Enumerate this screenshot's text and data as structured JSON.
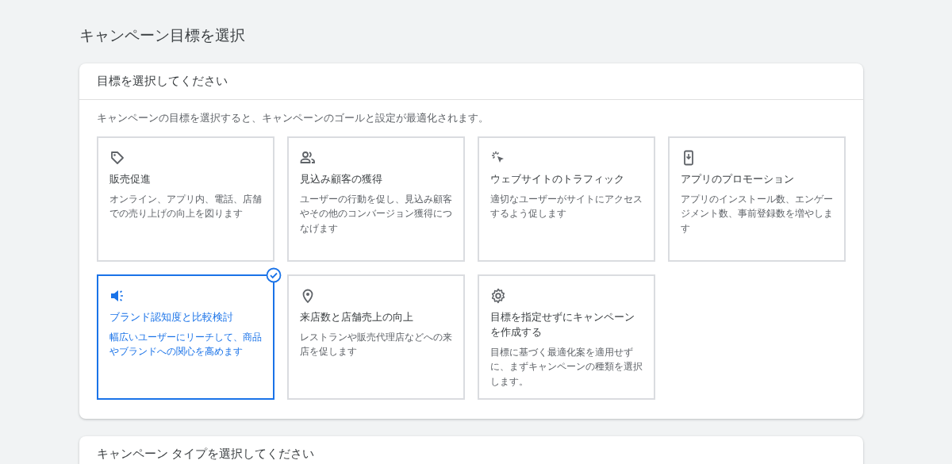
{
  "page_title": "キャンペーン目標を選択",
  "goal_card": {
    "title": "目標を選択してください",
    "description": "キャンペーンの目標を選択すると、キャンペーンのゴールと設定が最適化されます。",
    "goals": [
      {
        "kind": "tag",
        "title": "販売促進",
        "description": "オンライン、アプリ内、電話、店舗での売り上げの向上を図ります",
        "selected": false
      },
      {
        "kind": "people",
        "title": "見込み顧客の獲得",
        "description": "ユーザーの行動を促し、見込み顧客やその他のコンバージョン獲得につなげます",
        "selected": false
      },
      {
        "kind": "cursor",
        "title": "ウェブサイトのトラフィック",
        "description": "適切なユーザーがサイトにアクセスするよう促します",
        "selected": false
      },
      {
        "kind": "phone",
        "title": "アプリのプロモーション",
        "description": "アプリのインストール数、エンゲージメント数、事前登録数を増やします",
        "selected": false
      },
      {
        "kind": "megaphone",
        "title": "ブランド認知度と比較検討",
        "description": "幅広いユーザーにリーチして、商品やブランドへの関心を高めます",
        "selected": true
      },
      {
        "kind": "pin",
        "title": "来店数と店舗売上の向上",
        "description": "レストランや販売代理店などへの来店を促します",
        "selected": false
      },
      {
        "kind": "gear",
        "title": "目標を指定せずにキャンペーンを作成する",
        "description": "目標に基づく最適化案を適用せずに、まずキャンペーンの種類を選択します。",
        "selected": false
      }
    ]
  },
  "type_card": {
    "title": "キャンペーン タイプを選択してください"
  }
}
